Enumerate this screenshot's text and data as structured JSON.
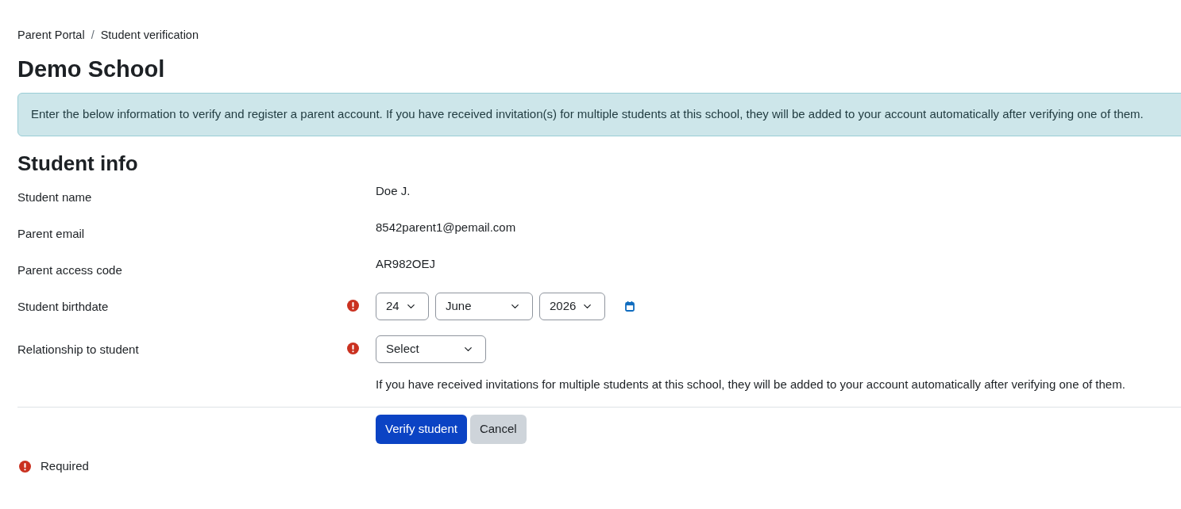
{
  "breadcrumb": {
    "items": [
      "Parent Portal",
      "Student verification"
    ],
    "separator": "/"
  },
  "title": "Demo School",
  "alert": "Enter the below information to verify and register a parent account. If you have received invitation(s) for multiple students at this school, they will be added to your account automatically after verifying one of them.",
  "section_title": "Student info",
  "fields": [
    {
      "kind": "static",
      "label": "Student name",
      "required": false,
      "value": "Doe J."
    },
    {
      "kind": "static",
      "label": "Parent email",
      "required": false,
      "value": "8542parent1@pemail.com"
    },
    {
      "kind": "static",
      "label": "Parent access code",
      "required": false,
      "value": "AR982OEJ"
    },
    {
      "kind": "date",
      "label": "Student birthdate",
      "required": true,
      "parts": [
        "24",
        "June",
        "2026"
      ]
    },
    {
      "kind": "select",
      "label": "Relationship to student",
      "required": true,
      "value": "Select",
      "help": "If you have received invitations for multiple students at this school, they will be added to your account automatically after verifying one of them."
    }
  ],
  "buttons": [
    {
      "label": "Verify student",
      "kind": "primary"
    },
    {
      "label": "Cancel",
      "kind": "secondary"
    }
  ],
  "legend": {
    "label": "Required"
  }
}
